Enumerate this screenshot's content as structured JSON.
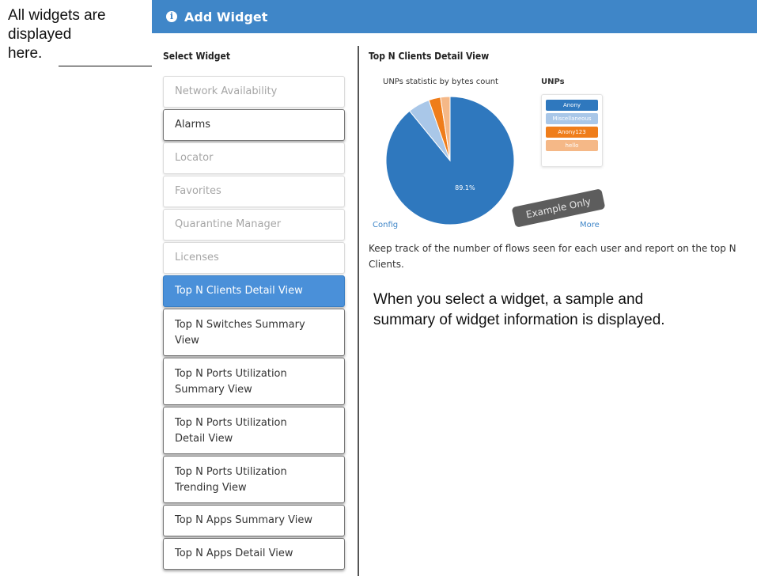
{
  "annotations": {
    "left": [
      "All widgets are",
      "displayed",
      "here."
    ],
    "right": [
      "When you select a widget, a sample and",
      "summary of widget information is displayed."
    ]
  },
  "header": {
    "title": "Add Widget",
    "icon": "info-icon",
    "color": "#3f86c8"
  },
  "select_label": "Select Widget",
  "widgets": [
    {
      "lines": [
        "Network Availability"
      ],
      "state": "disabled"
    },
    {
      "lines": [
        "Alarms"
      ],
      "state": "enabled"
    },
    {
      "lines": [
        "Locator"
      ],
      "state": "disabled"
    },
    {
      "lines": [
        "Favorites"
      ],
      "state": "disabled"
    },
    {
      "lines": [
        "Quarantine Manager"
      ],
      "state": "disabled"
    },
    {
      "lines": [
        "Licenses"
      ],
      "state": "disabled"
    },
    {
      "lines": [
        "Top N Clients Detail View"
      ],
      "state": "selected"
    },
    {
      "lines": [
        "Top N Switches Summary",
        "View"
      ],
      "state": "enabled"
    },
    {
      "lines": [
        "Top N Ports Utilization",
        "Summary View"
      ],
      "state": "enabled"
    },
    {
      "lines": [
        "Top N Ports Utilization",
        "Detail View"
      ],
      "state": "enabled"
    },
    {
      "lines": [
        "Top N Ports Utilization",
        "Trending View"
      ],
      "state": "enabled"
    },
    {
      "lines": [
        "Top N Apps Summary View"
      ],
      "state": "enabled"
    },
    {
      "lines": [
        "Top N Apps Detail View"
      ],
      "state": "enabled"
    }
  ],
  "detail": {
    "title": "Top N Clients Detail View",
    "chart_title": "UNPs statistic by bytes count",
    "legend_title": "UNPs",
    "config_link": "Config",
    "more_link": "More",
    "example_badge": "Example Only",
    "description": "Keep track of the number of flows seen for each user and report on the top N Clients."
  },
  "chart_data": {
    "type": "pie",
    "title": "UNPs statistic by bytes count",
    "legend_title": "UNPs",
    "slices": [
      {
        "label": "Anony",
        "value": 89.1,
        "color": "#2f78be",
        "show_label": "89.1%"
      },
      {
        "label": "Miscellaneous",
        "value": 5.5,
        "color": "#a9c7e8"
      },
      {
        "label": "Anony123",
        "value": 3.0,
        "color": "#ef7d1a"
      },
      {
        "label": "hello",
        "value": 2.4,
        "color": "#f5b887"
      }
    ]
  }
}
